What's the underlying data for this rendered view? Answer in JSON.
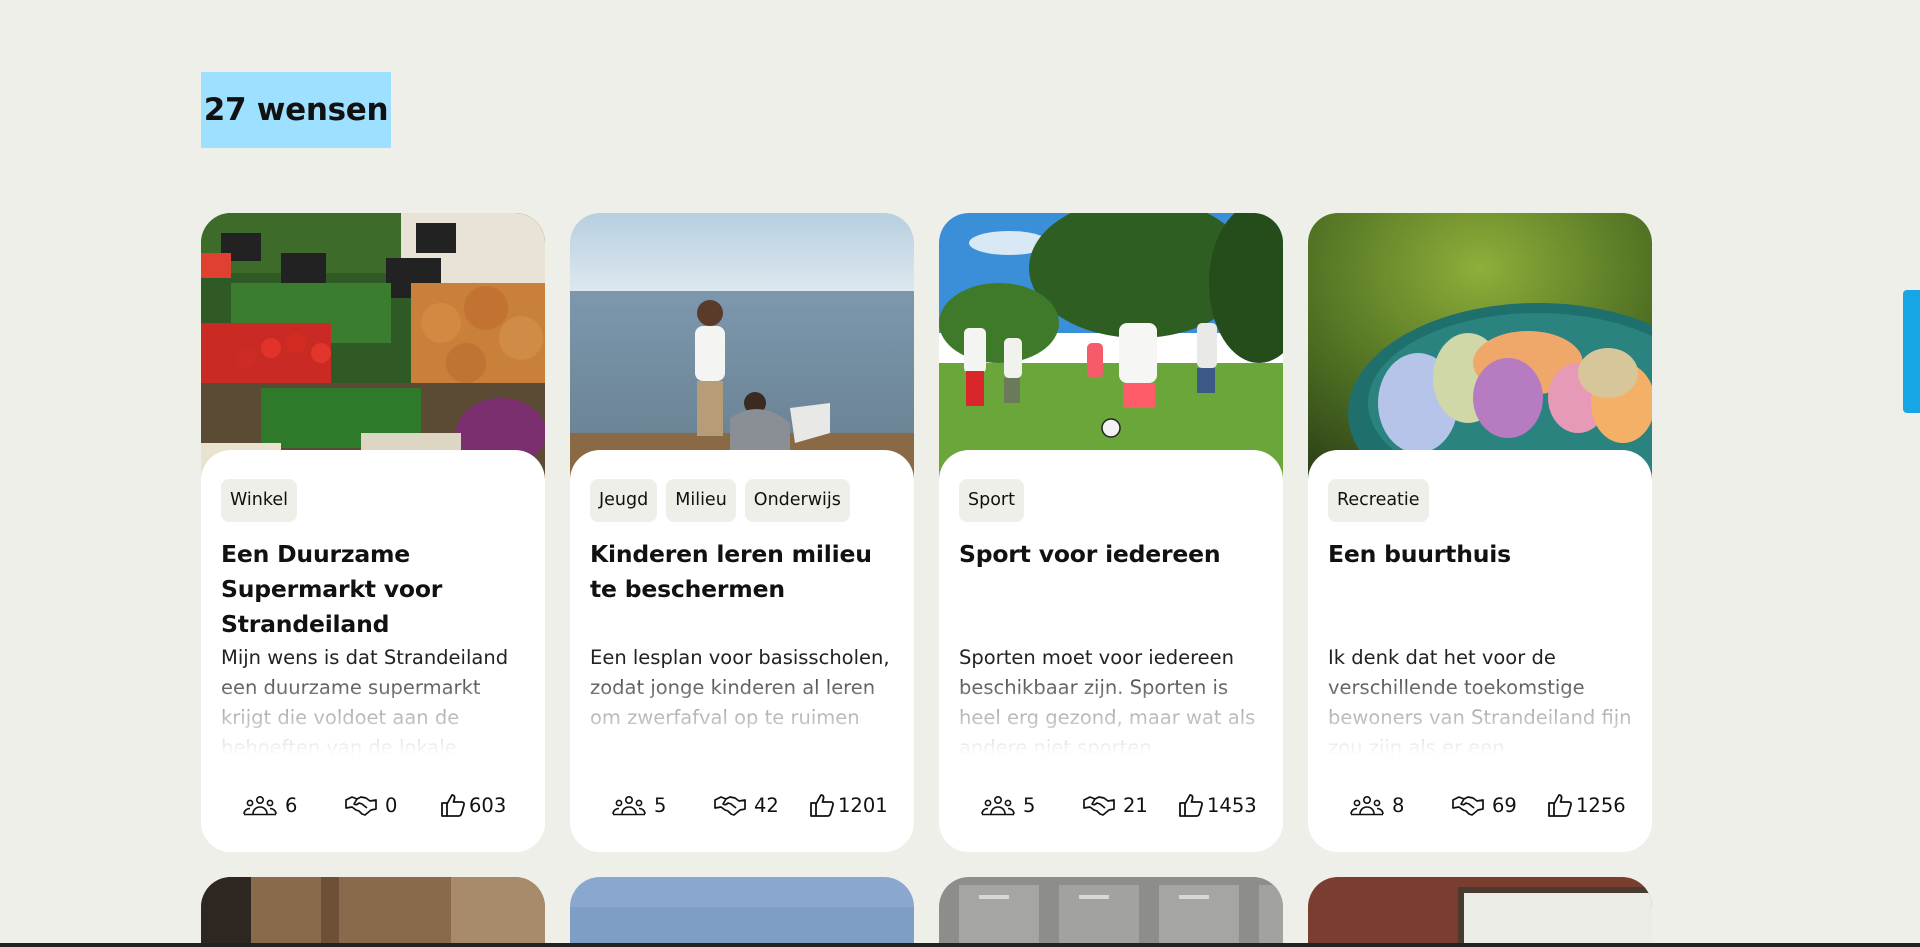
{
  "header": {
    "count_label": "27 wensen"
  },
  "cards": [
    {
      "tags": [
        "Winkel"
      ],
      "title": "Een Duurzame Supermarkt voor Strandeiland",
      "description": "Mijn wens is dat Strandeiland een duurzame supermarkt krijgt die voldoet aan de behoeften van de lokale",
      "stats": {
        "supporters": "6",
        "helpers": "0",
        "likes": "603"
      },
      "image_icon": "vegetable-market-image"
    },
    {
      "tags": [
        "Jeugd",
        "Milieu",
        "Onderwijs"
      ],
      "title": "Kinderen leren milieu te beschermen",
      "description": "Een lesplan voor basisscholen, zodat jonge kinderen al leren om zwerfafval op te ruimen",
      "stats": {
        "supporters": "5",
        "helpers": "42",
        "likes": "1201"
      },
      "image_icon": "children-beach-image"
    },
    {
      "tags": [
        "Sport"
      ],
      "title": "Sport voor iedereen",
      "description": "Sporten moet voor iedereen beschikbaar zijn. Sporten is heel erg gezond, maar wat als andere niet sporten",
      "stats": {
        "supporters": "5",
        "helpers": "21",
        "likes": "1453"
      },
      "image_icon": "kids-soccer-image"
    },
    {
      "tags": [
        "Recreatie"
      ],
      "title": "Een buurthuis",
      "description": "Ik denk dat het voor de verschillende toekomstige bewoners van Strandeiland fijn zou zijn als er een",
      "stats": {
        "supporters": "8",
        "helpers": "69",
        "likes": "1256"
      },
      "image_icon": "water-balloons-image"
    }
  ],
  "colors": {
    "background": "#efefea",
    "badge": "#9ee0ff",
    "accent": "#16a5e6",
    "tag_bg": "#efefea"
  }
}
